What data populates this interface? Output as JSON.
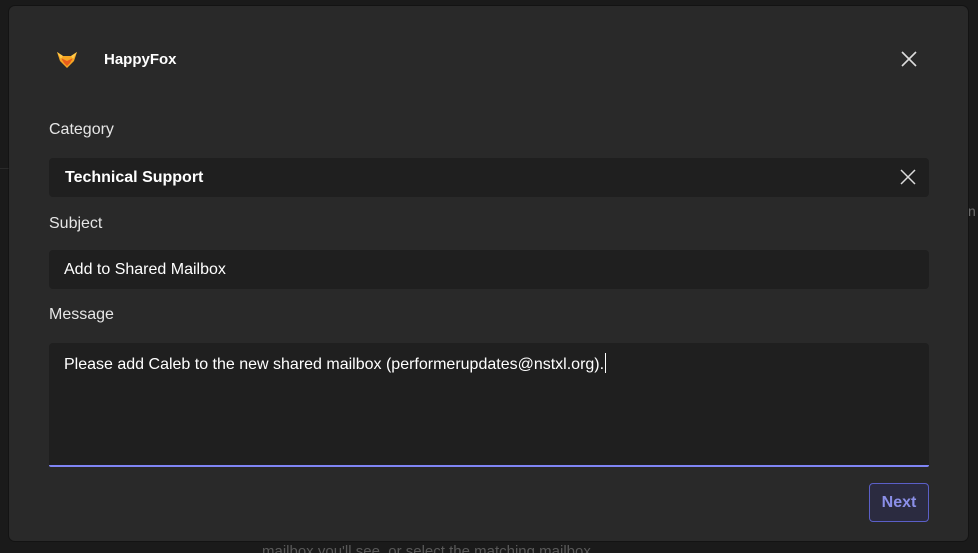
{
  "app": {
    "name": "HappyFox",
    "logo_icon": "fox-logo-icon",
    "accent_color": "#f5a623"
  },
  "form": {
    "category": {
      "label": "Category",
      "value": "Technical Support"
    },
    "subject": {
      "label": "Subject",
      "value": "Add to Shared Mailbox"
    },
    "message": {
      "label": "Message",
      "value": "Please add Caleb to the new shared mailbox (performerupdates@nstxl.org)."
    }
  },
  "actions": {
    "next_label": "Next",
    "close_icon": "close-icon",
    "clear_icon": "clear-icon",
    "focus_color": "#7f85f5"
  },
  "background": {
    "right_fragment": "n",
    "bottom_fragment": "mailbox you'll see, or select the matching mailbox."
  }
}
